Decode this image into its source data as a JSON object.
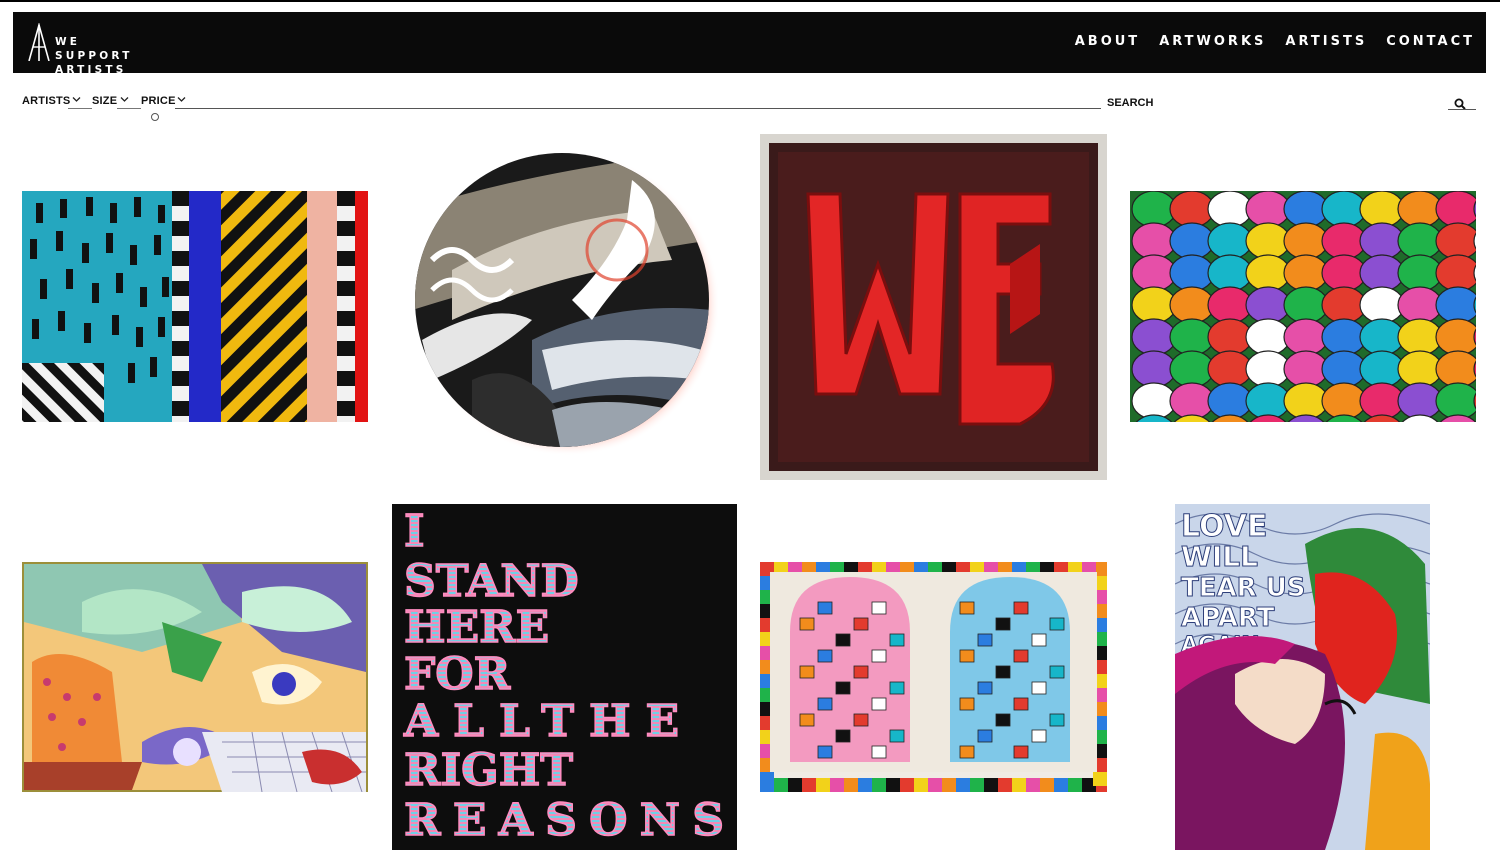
{
  "brand": {
    "name_lines": [
      "WE",
      "SUPPORT",
      "ARTISTS"
    ]
  },
  "nav": {
    "items": [
      {
        "label": "ABOUT"
      },
      {
        "label": "ARTWORKS"
      },
      {
        "label": "ARTISTS"
      },
      {
        "label": "CONTACT"
      }
    ]
  },
  "filters": {
    "artists_label": "ARTISTS",
    "size_label": "SIZE",
    "price_label": "PRICE",
    "search_label": "SEARCH"
  },
  "artworks": [
    {
      "description": "geometric stripes painting"
    },
    {
      "description": "circular abstract brushstroke painting"
    },
    {
      "description": "framed red WE lettering"
    },
    {
      "description": "colourful heads crowd painting"
    },
    {
      "description": "surreal botanical painting"
    },
    {
      "description": "typographic sign painting"
    },
    {
      "description": "patterned two heads painting"
    },
    {
      "description": "pop art kiss painting"
    }
  ],
  "artwork_text": {
    "sign_lines": [
      "I",
      "STAND",
      "HERE",
      "FOR",
      "ALLTHE",
      "RIGHT",
      "REASONS"
    ],
    "pop_lines": [
      "LOVE",
      "WILL",
      "TEAR US",
      "APART",
      "AGAIN"
    ]
  },
  "colors": {
    "header_bg": "#0a0a0a",
    "header_text": "#ffffff",
    "page_bg": "#ffffff"
  }
}
